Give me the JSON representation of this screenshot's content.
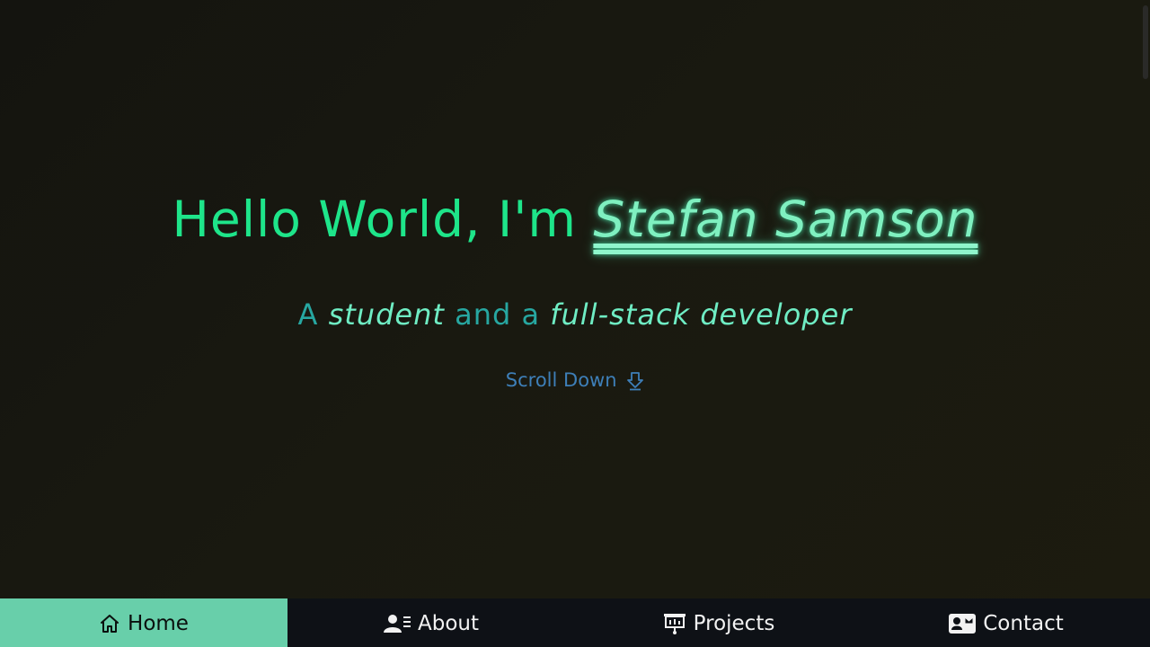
{
  "hero": {
    "greeting": "Hello World, I'm ",
    "name": "Stefan Samson",
    "sub_a": "A ",
    "sub_student": "student",
    "sub_and": " and a ",
    "sub_role": "full-stack developer",
    "scroll_label": "Scroll Down",
    "scroll_icon": "arrow-down-icon"
  },
  "nav": {
    "items": [
      {
        "label": "Home",
        "icon": "home-icon",
        "active": true
      },
      {
        "label": "About",
        "icon": "user-details-icon",
        "active": false
      },
      {
        "label": "Projects",
        "icon": "presentation-icon",
        "active": false
      },
      {
        "label": "Contact",
        "icon": "contact-card-icon",
        "active": false
      }
    ]
  },
  "colors": {
    "background": "#191910",
    "greeting": "#1ee58a",
    "name": "#7ff0c0",
    "subtitle": "#27a7a1",
    "scroll": "#3e7fb8",
    "nav_bg": "#0e1116",
    "nav_active": "#68cfaa"
  }
}
